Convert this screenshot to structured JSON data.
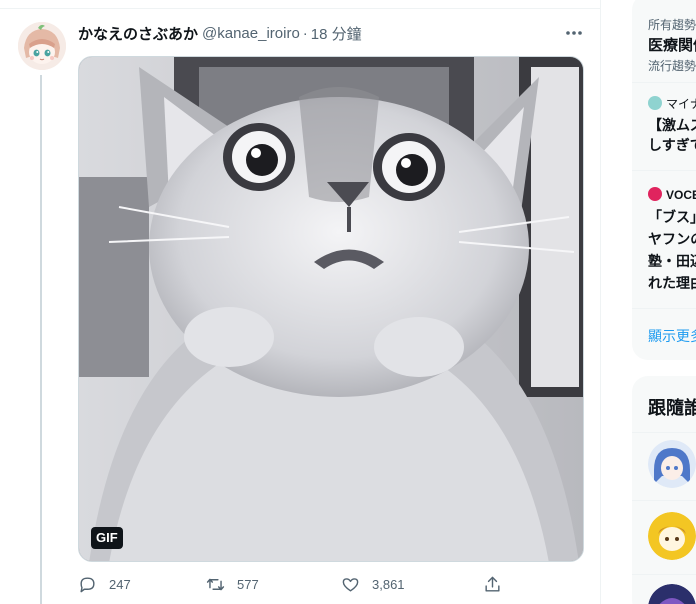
{
  "tweet": {
    "display_name": "かなえのさぶあか",
    "handle": "@kanae_iroiro",
    "separator": "·",
    "time": "18 分鐘",
    "more_label": "···",
    "media_badge": "GIF",
    "replies": "247",
    "retweets": "577",
    "likes": "3,861"
  },
  "sidebar": {
    "trend1_meta": "所有趨勢",
    "trend1_title": "医療関係",
    "trend1_sub": "流行趨勢",
    "news1_source": "マイナ",
    "news1_line1": "【激ムズ",
    "news1_line2": "しすぎて",
    "news2_source": "VOCE",
    "news2_line1": "「ブス」",
    "news2_line2": "ヤフンの",
    "news2_line3": "塾・田辺",
    "news2_line4": "れた理由",
    "show_more": "顯示更多",
    "follow_heading": "跟隨誰"
  },
  "colors": {
    "accent": "#1d9bf0",
    "text_secondary": "#536471",
    "border": "#eff3f4",
    "vote_pink": "#e0245e"
  },
  "icons": [
    "reply-icon",
    "retweet-icon",
    "like-icon",
    "share-icon",
    "more-icon",
    "gif-badge"
  ]
}
